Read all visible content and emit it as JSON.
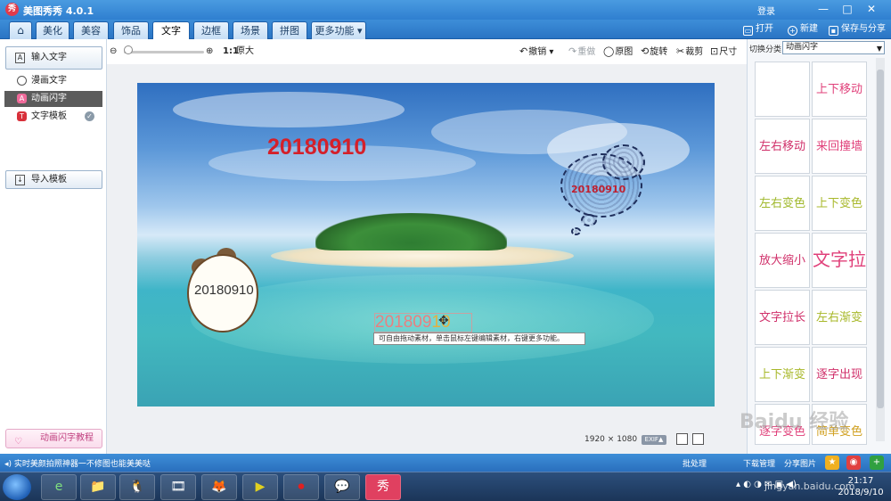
{
  "app": {
    "logo_char": "秀",
    "title": "美图秀秀 4.0.1",
    "login": "登录",
    "window_controls": [
      "—",
      "□",
      "✕"
    ]
  },
  "tabs": [
    {
      "label": "⌂",
      "icon": "home-icon"
    },
    {
      "label": "美化"
    },
    {
      "label": "美容"
    },
    {
      "label": "饰品"
    },
    {
      "label": "文字",
      "active": true
    },
    {
      "label": "边框"
    },
    {
      "label": "场景"
    },
    {
      "label": "拼图"
    },
    {
      "label": "更多功能 ▾"
    }
  ],
  "tab_actions": {
    "open": "打开",
    "new": "新建",
    "save_share": "保存与分享"
  },
  "left_panel": {
    "input_text_button": "输入文字",
    "items": [
      {
        "label": "漫画文字",
        "icon": "speech-bubble-icon"
      },
      {
        "label": "动画闪字",
        "icon": "animation-icon",
        "selected": true
      },
      {
        "label": "文字模板",
        "icon": "template-icon",
        "badge": "✓"
      }
    ],
    "import_template_button": "导入模板",
    "tutorial_button": "动画闪字教程"
  },
  "toolbar": {
    "zoom_ratio": "1:1",
    "original_size": "原大",
    "undo": "撤销",
    "redo": "重做",
    "original_image": "原图",
    "rotate": "旋转",
    "crop": "裁剪",
    "size": "尺寸"
  },
  "canvas": {
    "big_date": "20180910",
    "panda_text": "20180910",
    "selected_text_part1": "201809",
    "selected_text_part2": "10",
    "scribble_text": "20180910",
    "tooltip": "可自由拖动素材，单击鼠标左键编辑素材，右键更多功能。",
    "width": "1920",
    "times": "×",
    "height": "1080",
    "exif": "EXIF▲"
  },
  "right_panel": {
    "category_label": "切换分类",
    "category_value": "动画闪字",
    "effects": [
      {
        "label": "",
        "color": "#d23a6a"
      },
      {
        "label": "上下移动",
        "color": "#e0407a"
      },
      {
        "label": "左右移动",
        "color": "#d0306a"
      },
      {
        "label": "来回撞墙",
        "color": "#e0407a"
      },
      {
        "label": "左右变色",
        "color": "#9fb82a"
      },
      {
        "label": "上下变色",
        "color": "#a8b82a"
      },
      {
        "label": "放大缩小",
        "color": "#d0306a"
      },
      {
        "label": "文字拉高",
        "color": "#e0407a"
      },
      {
        "label": "文字拉长",
        "color": "#d0306a"
      },
      {
        "label": "左右渐变",
        "color": "#a8b82a"
      },
      {
        "label": "上下渐变",
        "color": "#a8b82a"
      },
      {
        "label": "逐字出现",
        "color": "#d0306a"
      },
      {
        "label": "逐字变色",
        "color": "#e0407a"
      },
      {
        "label": "简单变色",
        "color": "#d0a020"
      }
    ]
  },
  "notice_bar": {
    "message": "实时美颜拍照神器一不修图也能美美哒",
    "batch": "批处理",
    "download": "下载管理",
    "share": "分享图片"
  },
  "taskbar": {
    "apps": [
      "e",
      "📁",
      "🐧",
      "🎞",
      "🦊",
      "▶",
      "⏺",
      "💬",
      "秀"
    ],
    "clock_time": "21:17",
    "clock_date": "2018/9/10"
  },
  "watermark": {
    "line1": "Baidu 经验",
    "line2": "jingyan.baidu.com"
  },
  "colors": {
    "title_blue": "#2f7fd0",
    "date_red": "#d4202a",
    "selected_item_bg": "#5b5b5b"
  }
}
